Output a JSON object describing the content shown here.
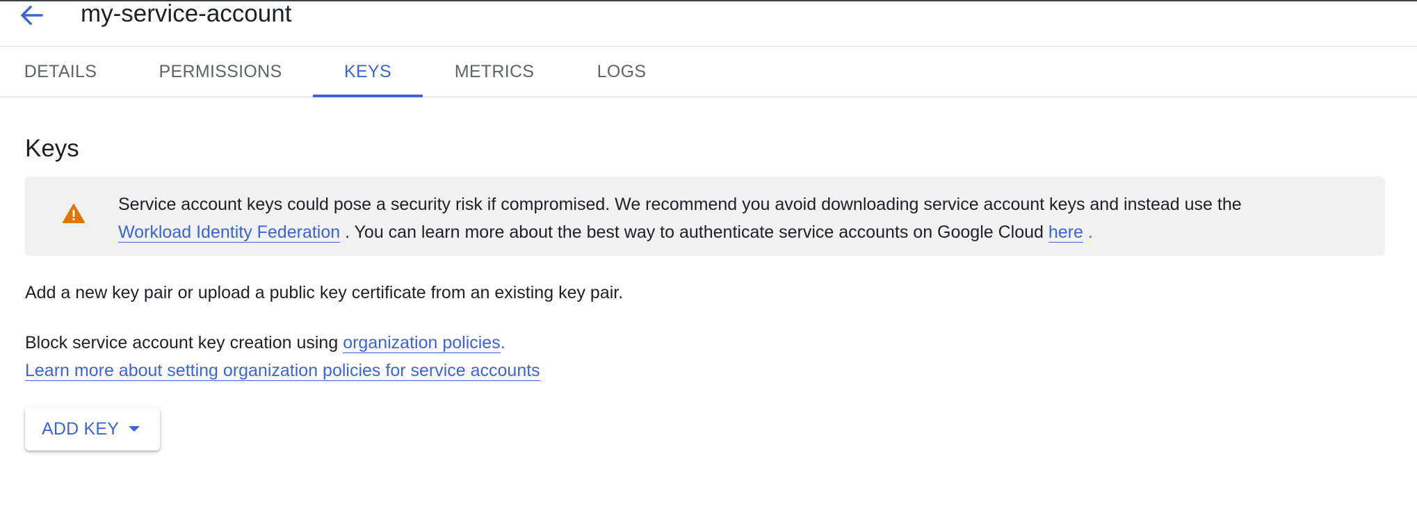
{
  "header": {
    "title": "my-service-account"
  },
  "tabs": [
    {
      "label": "DETAILS",
      "active": false
    },
    {
      "label": "PERMISSIONS",
      "active": false
    },
    {
      "label": "KEYS",
      "active": true
    },
    {
      "label": "METRICS",
      "active": false
    },
    {
      "label": "LOGS",
      "active": false
    }
  ],
  "section": {
    "title": "Keys"
  },
  "alert": {
    "icon": "warning-icon",
    "text_before": "Service account keys could pose a security risk if compromised. We recommend you avoid downloading service account keys and instead use the",
    "link1": "Workload Identity Federation",
    "text_mid": ". You can learn more about the best way to authenticate service accounts on Google Cloud",
    "link2": "here",
    "text_end": "."
  },
  "body": {
    "add_key_pair_text": "Add a new key pair or upload a public key certificate from an existing key pair.",
    "block_text": "Block service account key creation using",
    "org_policies_link": "organization policies",
    "block_end": ".",
    "learn_more_link": "Learn more about setting organization policies for service accounts"
  },
  "actions": {
    "add_key_label": "ADD KEY"
  },
  "colors": {
    "accent": "#3c64d2",
    "warning": "#e37400",
    "alert_bg": "#f1f1f1"
  }
}
